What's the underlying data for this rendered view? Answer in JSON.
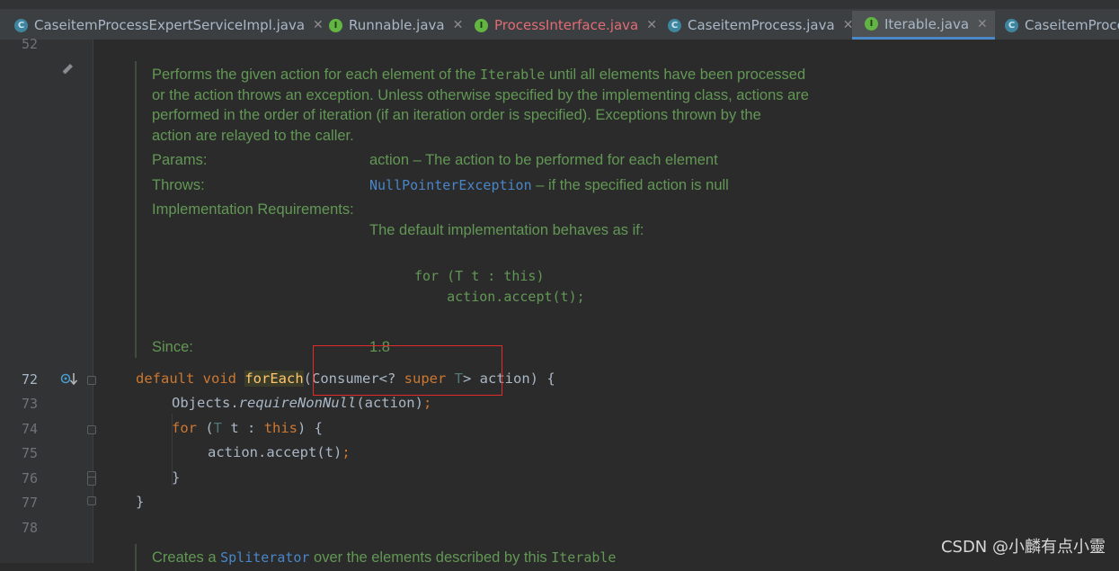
{
  "tabs": [
    {
      "icon": "C",
      "label": "CaseitemProcessExpertServiceImpl.java",
      "active": false,
      "error": false
    },
    {
      "icon": "I",
      "label": "Runnable.java",
      "active": false,
      "error": false
    },
    {
      "icon": "I",
      "label": "ProcessInterface.java",
      "active": false,
      "error": true
    },
    {
      "icon": "C",
      "label": "CaseitemProcess.java",
      "active": false,
      "error": false
    },
    {
      "icon": "I",
      "label": "Iterable.java",
      "active": true,
      "error": false
    },
    {
      "icon": "C",
      "label": "CaseitemProce",
      "active": false,
      "error": false
    }
  ],
  "close_glyph": "✕",
  "line_numbers": {
    "top": "52",
    "l72": "72",
    "l73": "73",
    "l74": "74",
    "l75": "75",
    "l76": "76",
    "l77": "77",
    "l78": "78"
  },
  "doc": {
    "p1": "Performs the given action for each element of the ",
    "p1_code": "Iterable",
    "p1_end": " until all elements have been processed",
    "p2": "or the action throws an exception. Unless otherwise specified by the implementing class, actions are",
    "p3": "performed in the order of iteration (if an iteration order is specified). Exceptions thrown by the",
    "p4": "action are relayed to the caller.",
    "params_label": "Params:",
    "params_value": "action – The action to be performed for each element",
    "throws_label": "Throws:",
    "throws_link": "NullPointerException",
    "throws_rest": " – if the specified action is null",
    "impl_label": "Implementation Requirements:",
    "impl_value": "The default implementation behaves as if:",
    "impl_code1": "for (T t : this)",
    "impl_code2": "    action.accept(t);",
    "since_label": "Since:",
    "since_value": "1.8",
    "next_pre": "Creates a ",
    "next_link": "Spliterator",
    "next_mid": " over the elements described by this ",
    "next_code": "Iterable"
  },
  "code": {
    "l72_kw1": "default",
    "l72_kw2": "void",
    "l72_fn": "forEach",
    "l72_a": "(Consumer<? ",
    "l72_super": "super",
    "l72_T": "T",
    "l72_b": "> action) {",
    "l73_a": "Objects.",
    "l73_m": "requireNonNull",
    "l73_b": "(action)",
    "l74_for": "for",
    "l74_a": " (",
    "l74_T": "T",
    "l74_b": " t : ",
    "l74_this": "this",
    "l74_c": ") {",
    "l75": "action.accept(t)",
    "l76": "}",
    "l77": "}",
    "semi": ";"
  },
  "watermark": "CSDN @小麟有点小靈",
  "colors": {
    "background": "#2b2b2b",
    "doc_green": "#629755",
    "keyword": "#cc7832",
    "highlight_box": "#e52a2a",
    "active_tab_underline": "#4a88c7"
  }
}
